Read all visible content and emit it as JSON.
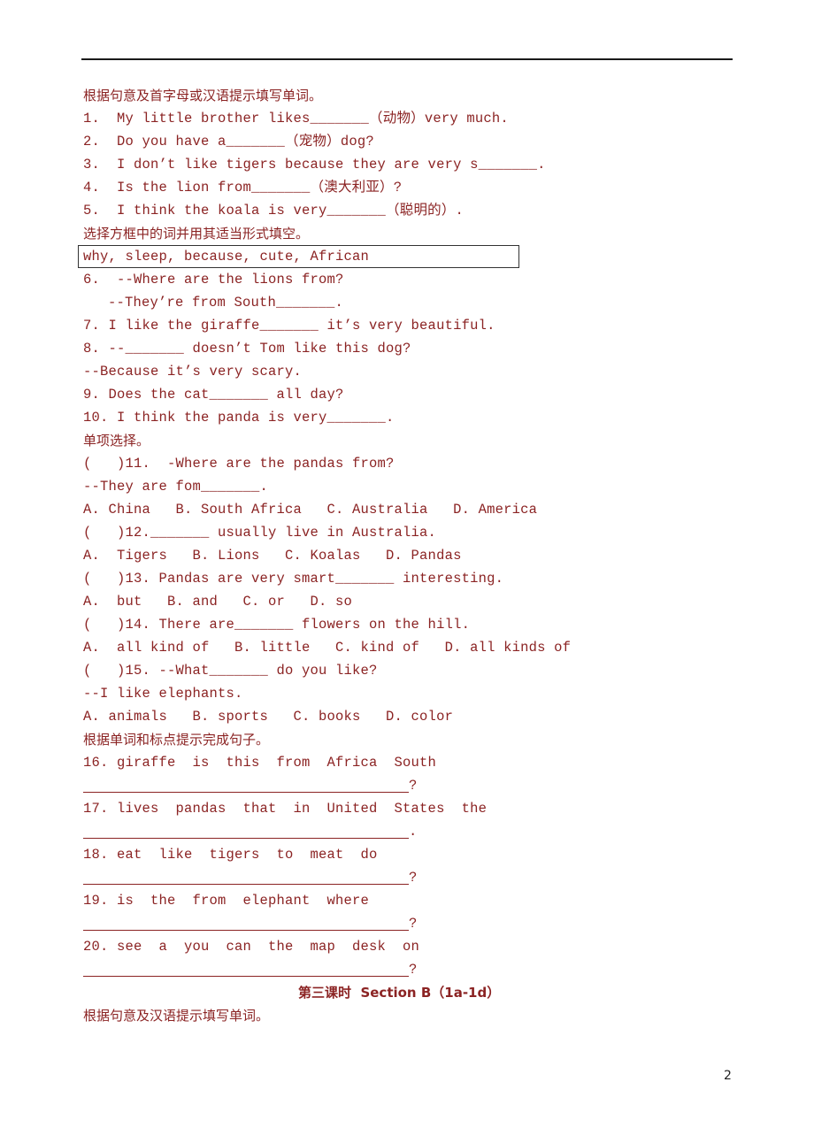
{
  "page_number": "2",
  "sections": {
    "s1_heading": "根据句意及首字母或汉语提示填写单词。",
    "s1_items": [
      "1.  My little brother likes_______（动物）very much.",
      "2.  Do you have a_______（宠物）dog?",
      "3.  I don’t like tigers because they are very s_______.",
      "4.  Is the lion from_______（澳大利亚）?",
      "5.  I think the koala is very_______（聪明的）."
    ],
    "s2_heading": "选择方框中的词并用其适当形式填空。",
    "s2_word_box": "why, sleep, because, cute, African",
    "s2_items": [
      "6.  --Where are the lions from?",
      "--They’re from South_______.",
      "7. I like the giraffe_______ it’s very beautiful.",
      "8. --_______ doesn’t Tom like this dog?",
      "--Because it’s very scary.",
      "9. Does the cat_______ all day?",
      "10. I think the panda is very_______."
    ],
    "s3_heading": "单项选择。",
    "s3_items": [
      "(   )11.  -Where are the pandas from?",
      "--They are fom_______.",
      "A. China   B. South Africa   C. Australia   D. America",
      "(   )12._______ usually live in Australia.",
      "A.  Tigers   B. Lions   C. Koalas   D. Pandas",
      "(   )13. Pandas are very smart_______ interesting.",
      "A.  but   B. and   C. or   D. so",
      "(   )14. There are_______ flowers on the hill.",
      "A.  all kind of   B. little   C. kind of   D. all kinds of",
      "(   )15. --What_______ do you like?",
      "--I like elephants.",
      "A. animals   B. sports   C. books   D. color"
    ],
    "s4_heading": "根据单词和标点提示完成句子。",
    "s4_items": [
      {
        "words": "16. giraffe  is  this  from  Africa  South",
        "end": "?"
      },
      {
        "words": "17. lives  pandas  that  in  United  States  the",
        "end": "."
      },
      {
        "words": "18. eat  like  tigers  to  meat  do",
        "end": "?"
      },
      {
        "words": "19. is  the  from  elephant  where",
        "end": "?"
      },
      {
        "words": "20. see  a  you  can  the  map  desk  on",
        "end": "?"
      }
    ],
    "lesson_title": "第三课时  Section B（1a-1d）",
    "s5_heading": "根据句意及汉语提示填写单词。"
  }
}
